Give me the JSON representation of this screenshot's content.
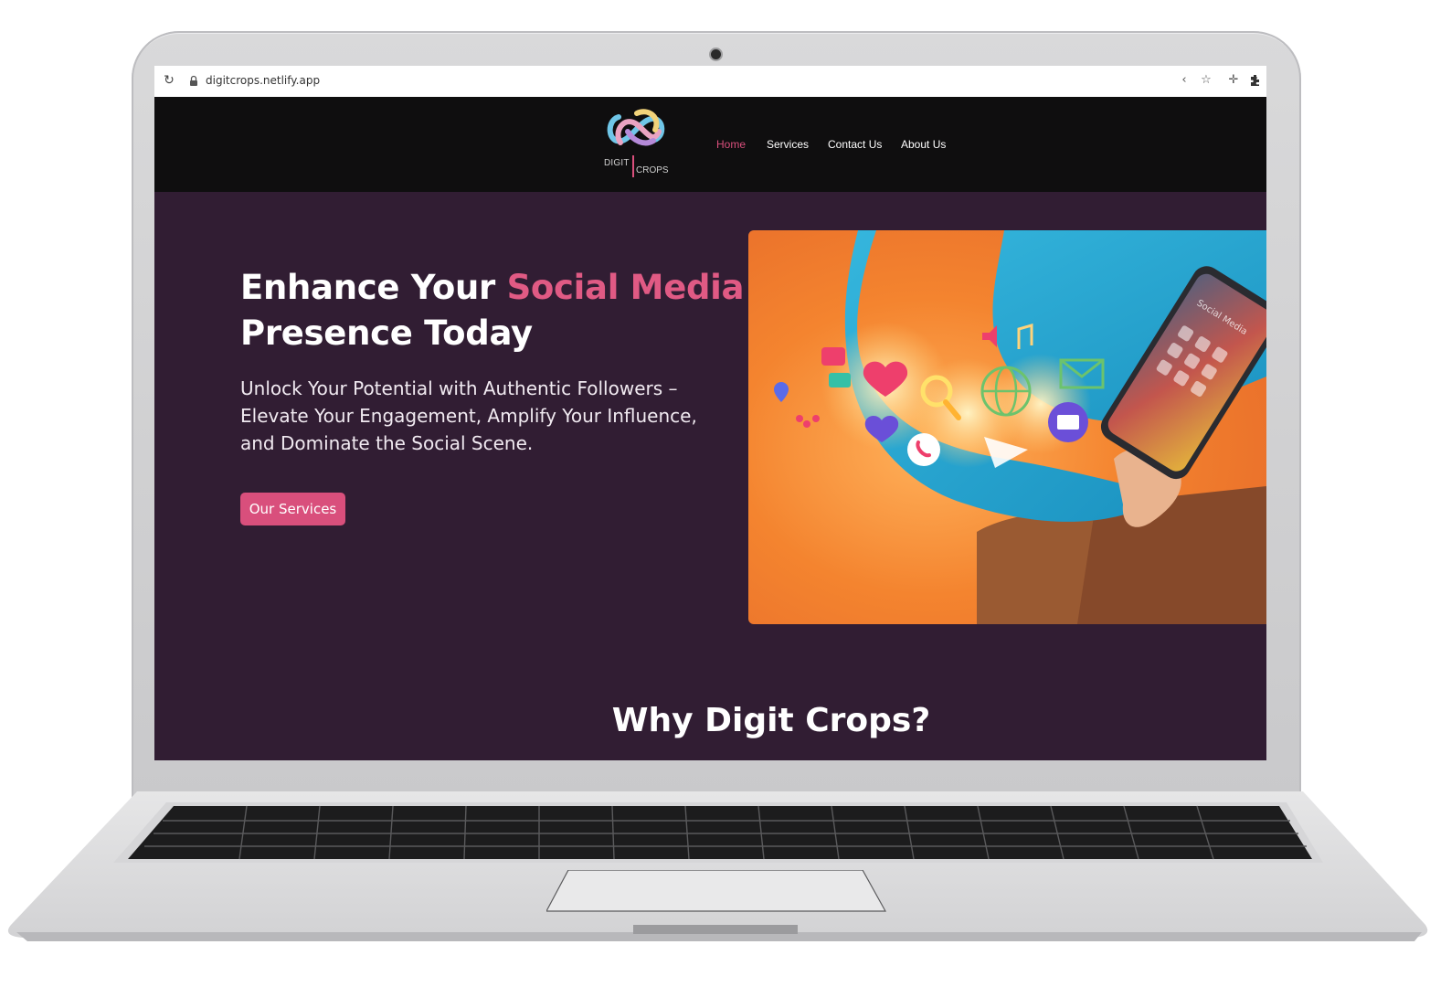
{
  "browser": {
    "url": "digitcrops.netlify.app",
    "icons": [
      "reload-icon",
      "lock-icon",
      "share-icon",
      "star-icon",
      "move-icon",
      "extensions-icon"
    ]
  },
  "nav": {
    "logo": {
      "word1": "DIGIT",
      "word2": "CROPS"
    },
    "links": [
      {
        "label": "Home",
        "active": true
      },
      {
        "label": "Services",
        "active": false
      },
      {
        "label": "Contact Us",
        "active": false
      },
      {
        "label": "About Us",
        "active": false
      }
    ]
  },
  "hero": {
    "title_part1": "Enhance Your ",
    "title_accent": "Social Media",
    "title_part2": "Presence Today",
    "subtitle": "Unlock Your Potential with Authentic Followers – Elevate Your Engagement, Amplify Your Influence, and Dominate the Social Scene.",
    "cta_label": "Our Services",
    "image_phone_text": "Social Media"
  },
  "section": {
    "why_heading": "Why Digit Crops?"
  },
  "colors": {
    "accent": "#d94f7c",
    "page_bg": "#311d33",
    "nav_bg": "#0f0e0f"
  }
}
